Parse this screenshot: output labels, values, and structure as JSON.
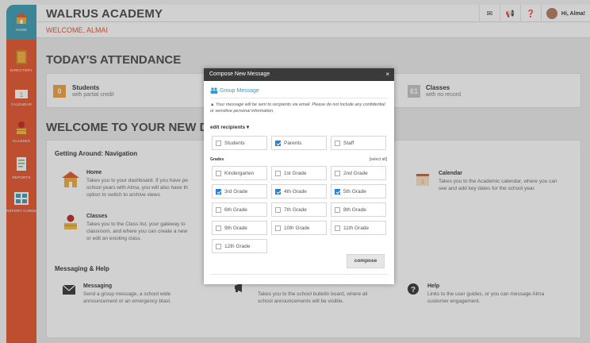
{
  "app": {
    "title": "WALRUS ACADEMY",
    "welcome": "WELCOME, ALMAI"
  },
  "header": {
    "user_label": "Hi, Alma!"
  },
  "sidebar": {
    "items": [
      {
        "label": "HOME"
      },
      {
        "label": "DIRECTORY"
      },
      {
        "label": "CALENDAR"
      },
      {
        "label": "CLASSES"
      },
      {
        "label": "REPORTS"
      },
      {
        "label": "REPORT CARDS"
      }
    ]
  },
  "attendance": {
    "title": "TODAY'S ATTENDANCE",
    "students": {
      "count": "0",
      "label": "Students",
      "sub": "with partial credit"
    },
    "classes": {
      "count": "61",
      "label": "Classes",
      "sub": "with no record"
    }
  },
  "dashboard": {
    "title": "WELCOME TO YOUR NEW DASH",
    "nav_heading": "Getting Around: Navigation",
    "home": {
      "title": "Home",
      "desc1": "Takes you to your dashboard. If you have pe",
      "desc2": "school years with Alma, you will also have th",
      "desc3": "option to switch to archive views"
    },
    "classes": {
      "title": "Classes",
      "desc1": "Takes you to the Class list, your gateway to",
      "desc2": "classroom, and where you can create a new",
      "desc3": "or edit an existing class."
    },
    "calendar": {
      "title": "Calendar",
      "desc1": "Takes you to the Academic calendar, where you can",
      "desc2": "see and add key dates for the school year."
    },
    "msg_heading": "Messaging & Help",
    "messaging": {
      "title": "Messaging",
      "desc1": "Send a group message, a school wide",
      "desc2": "announcement or an emergency blast."
    },
    "bulletin": {
      "desc1": "Takes you to the school bulletin board, where all",
      "desc2": "school announcements will be visible."
    },
    "help": {
      "title": "Help",
      "desc1": "Links to the user guides, or you can message Alma",
      "desc2": "customer engagement."
    }
  },
  "modal": {
    "title": "Compose New Message",
    "close": "×",
    "group_message": "Group Message",
    "warning": "Your message will be sent to recipients via email. Please do not include any confidential or sensitive personal information.",
    "edit_recipients": "edit recipients",
    "recipients": [
      {
        "label": "Students",
        "checked": false
      },
      {
        "label": "Parents",
        "checked": true
      },
      {
        "label": "Staff",
        "checked": false
      }
    ],
    "grades_label": "Grades",
    "select_all": "[select all]",
    "grades": [
      {
        "label": "Kindergarten",
        "checked": false
      },
      {
        "label": "1st Grade",
        "checked": false
      },
      {
        "label": "2nd Grade",
        "checked": false
      },
      {
        "label": "3rd Grade",
        "checked": true
      },
      {
        "label": "4th Grade",
        "checked": true
      },
      {
        "label": "5th Grade",
        "checked": true
      },
      {
        "label": "6th Grade",
        "checked": false
      },
      {
        "label": "7th Grade",
        "checked": false
      },
      {
        "label": "8th Grade",
        "checked": false
      },
      {
        "label": "9th Grade",
        "checked": false
      },
      {
        "label": "10th Grade",
        "checked": false
      },
      {
        "label": "11th Grade",
        "checked": false
      },
      {
        "label": "12th Grade",
        "checked": false
      }
    ],
    "compose": "compose"
  },
  "colors": {
    "sidebar": "#e8603b",
    "active": "#4aa3b8",
    "accent": "#2b9cd8",
    "check": "#2b7fd8"
  }
}
